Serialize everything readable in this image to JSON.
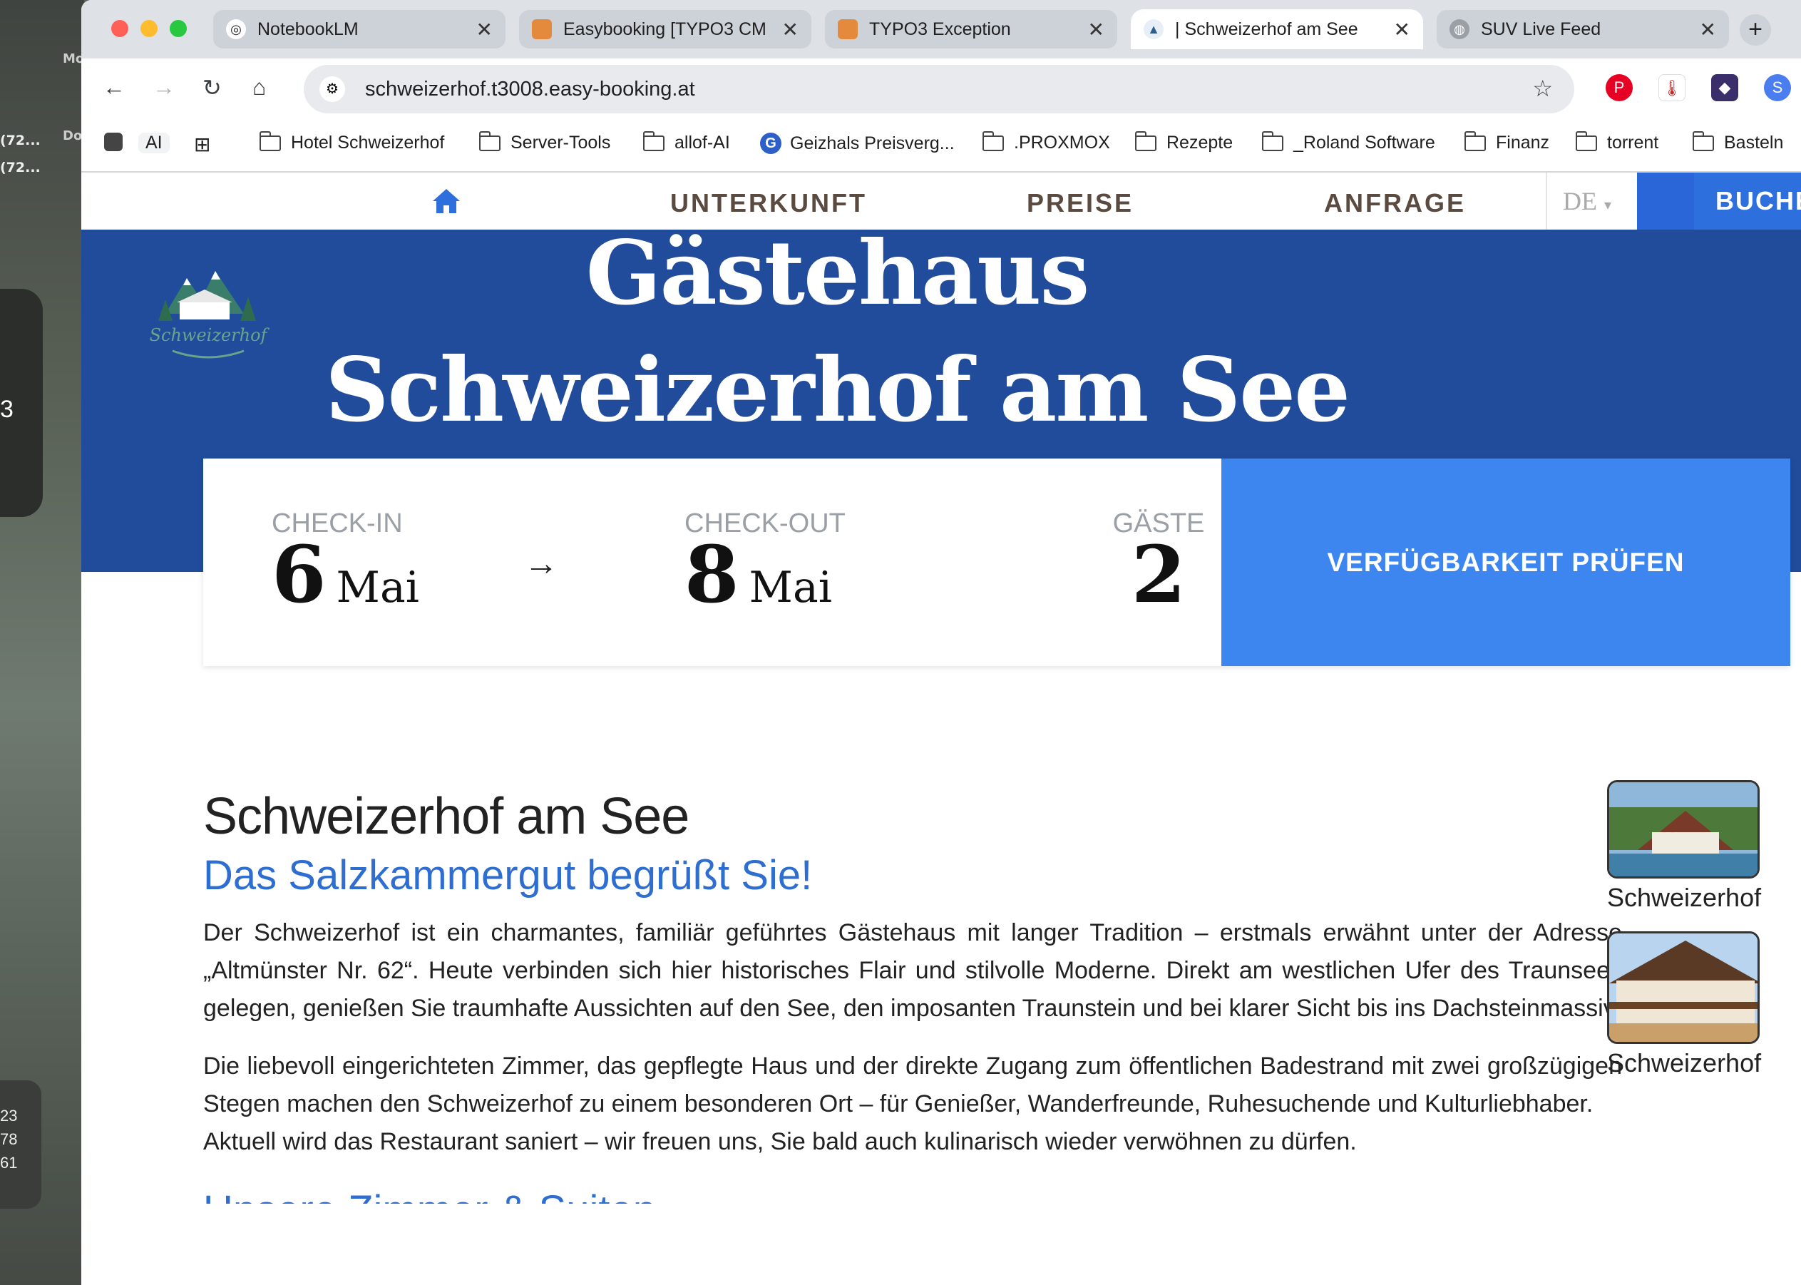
{
  "desktop": {
    "labels": [
      "Mo",
      "(72...",
      "(72...",
      "Do",
      "3"
    ],
    "numbers": [
      "23",
      "78",
      "61"
    ]
  },
  "browser": {
    "tabs": [
      {
        "title": "NotebookLM",
        "active": false
      },
      {
        "title": "Easybooking [TYPO3 CM",
        "active": false
      },
      {
        "title": "TYPO3 Exception",
        "active": false
      },
      {
        "title": "| Schweizerhof am See",
        "active": true
      },
      {
        "title": "SUV Live Feed",
        "active": false
      }
    ],
    "new_tab": "+",
    "url": "schweizerhof.t3008.easy-booking.at",
    "bookmarks": [
      "AI",
      "Hotel Schweizerhof",
      "Server-Tools",
      "allof-AI",
      "Geizhals Preisverg...",
      ".PROXMOX",
      "Rezepte",
      "_Roland Software",
      "Finanz",
      "torrent",
      "Basteln"
    ]
  },
  "site": {
    "nav": {
      "home_icon": "home-icon",
      "items": [
        "UNTERKUNFT",
        "PREISE",
        "ANFRAGE"
      ],
      "lang": "DE",
      "book": "BUCHE"
    },
    "hero": {
      "title": "Gästehaus Schweizerhof am See",
      "logo_text": "Schweizerhof"
    },
    "booking": {
      "checkin_label": "CHECK-IN",
      "checkin_day": "6",
      "checkin_month": "Mai",
      "checkout_label": "CHECK-OUT",
      "checkout_day": "8",
      "checkout_month": "Mai",
      "guests_label": "GÄSTE",
      "guests": "2",
      "arrow": "→",
      "button": "VERFÜGBARKEIT PRÜFEN"
    },
    "content": {
      "heading": "Schweizerhof am See",
      "subheading": "Das Salzkammergut begrüßt Sie!",
      "para1": "Der Schweizerhof ist ein charmantes, familiär geführtes Gästehaus mit langer Tradition – erstmals erwähnt unter der Adresse „Altmünster Nr. 62“. Heute verbinden sich hier historisches Flair und stilvolle Moderne. Direkt am westlichen Ufer des Traunsees gelegen, genießen Sie traumhafte Aussichten auf den See, den imposanten Traunstein und bei klarer Sicht bis ins Dachsteinmassiv.",
      "para2": "Die liebevoll eingerichteten Zimmer, das gepflegte Haus und der direkte Zugang zum öffentlichen Badestrand mit zwei großzügigen Stegen machen den Schweizerhof zu einem besonderen Ort – für Genießer, Wanderfreunde, Ruhesuchende und Kulturliebhaber.",
      "para3": "Aktuell wird das Restaurant saniert – wir freuen uns, Sie bald auch kulinarisch wieder verwöhnen zu dürfen.",
      "next_heading": "Unsere Zimmer & Suiten"
    },
    "thumbnails": [
      {
        "caption": "Schweizerhof"
      },
      {
        "caption": "Schweizerhof"
      }
    ]
  },
  "colors": {
    "hero_blue": "#214c9c",
    "accent_blue": "#3d86f0",
    "link_blue": "#2f6ed1",
    "nav_brown": "#5a4a3f"
  }
}
